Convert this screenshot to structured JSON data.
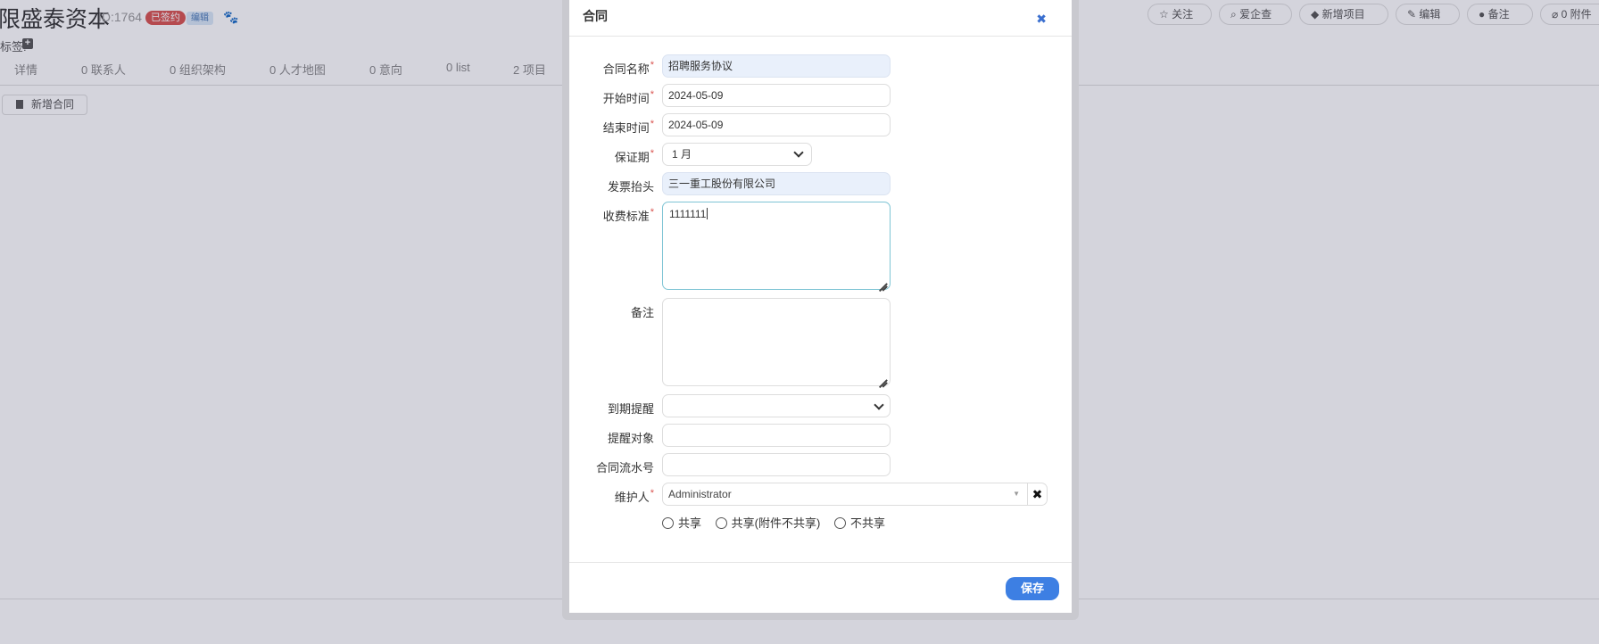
{
  "background": {
    "company_name": "限盛泰资本",
    "company_id": "ID:1764",
    "status_badge": "已签约",
    "edit_badge": "编辑",
    "tag_label": "标签:",
    "tabs": [
      {
        "label": "详情"
      },
      {
        "label": "0 联系人"
      },
      {
        "label": "0 组织架构"
      },
      {
        "label": "0 人才地图"
      },
      {
        "label": "0 意向"
      },
      {
        "label": "0 list"
      },
      {
        "label": "2 项目"
      }
    ],
    "new_contract_label": "新增合同",
    "actions": [
      {
        "label": "☆ 关注"
      },
      {
        "label": "爱企查"
      },
      {
        "label": "新增项目"
      },
      {
        "label": "编辑"
      },
      {
        "label": "备注"
      },
      {
        "label": "0 附件"
      }
    ]
  },
  "modal": {
    "title": "合同",
    "close_glyph": "✖",
    "fields": {
      "contract_name": {
        "label": "合同名称",
        "value": "招聘服务协议"
      },
      "start_date": {
        "label": "开始时间",
        "value": "2024-05-09"
      },
      "end_date": {
        "label": "结束时间",
        "value": "2024-05-09"
      },
      "warranty": {
        "label": "保证期",
        "value": "1 月"
      },
      "invoice_title": {
        "label": "发票抬头",
        "value": "三一重工股份有限公司"
      },
      "fee_standard": {
        "label": "收费标准",
        "value": "1111111"
      },
      "remark": {
        "label": "备注",
        "value": ""
      },
      "expiry_reminder": {
        "label": "到期提醒",
        "value": ""
      },
      "reminder_target": {
        "label": "提醒对象",
        "value": ""
      },
      "serial_number": {
        "label": "合同流水号",
        "value": ""
      },
      "maintainer": {
        "label": "维护人",
        "value": "Administrator"
      }
    },
    "required_mark": "*",
    "sharing_options": [
      {
        "label": "共享"
      },
      {
        "label": "共享(附件不共享)"
      },
      {
        "label": "不共享"
      }
    ],
    "save_label": "保存"
  },
  "colors": {
    "accent": "#3d7fe3",
    "required": "#d9534f",
    "filled_input": "#e9f0fb"
  }
}
